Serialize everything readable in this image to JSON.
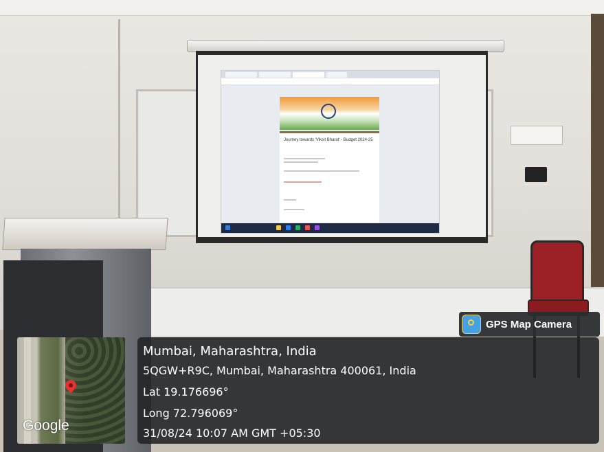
{
  "overlay": {
    "brand": "GPS Map Camera",
    "location_title": "Mumbai, Maharashtra, India",
    "address": "5QGW+R9C, Mumbai, Maharashtra 400061, India",
    "latitude": "Lat 19.176696°",
    "longitude": "Long 72.796069°",
    "timestamp": "31/08/24 10:07 AM GMT +05:30",
    "map_brand": "Google"
  },
  "projection": {
    "form_title": "Journey towards 'Viksit Bharat' - Budget 2024-25"
  }
}
